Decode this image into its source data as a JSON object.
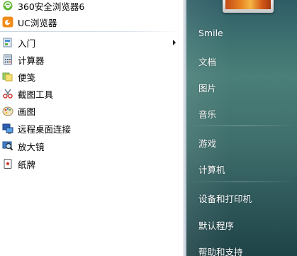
{
  "programs": {
    "pinned": [
      {
        "label": "360安全浏览器6",
        "icon": "360-browser-icon"
      },
      {
        "label": "UC浏览器",
        "icon": "uc-browser-icon"
      }
    ],
    "items": [
      {
        "label": "入门",
        "icon": "getting-started-icon",
        "has_submenu": true
      },
      {
        "label": "计算器",
        "icon": "calculator-icon"
      },
      {
        "label": "便笺",
        "icon": "sticky-notes-icon"
      },
      {
        "label": "截图工具",
        "icon": "snipping-tool-icon"
      },
      {
        "label": "画图",
        "icon": "paint-icon"
      },
      {
        "label": "远程桌面连接",
        "icon": "remote-desktop-icon"
      },
      {
        "label": "放大镜",
        "icon": "magnifier-icon"
      },
      {
        "label": "纸牌",
        "icon": "solitaire-icon"
      }
    ]
  },
  "places": [
    {
      "label": "Smile"
    },
    {
      "label": "文档"
    },
    {
      "label": "图片"
    },
    {
      "label": "音乐"
    },
    {
      "label": "游戏"
    },
    {
      "label": "计算机"
    },
    {
      "label": "设备和打印机"
    },
    {
      "label": "默认程序"
    },
    {
      "label": "帮助和支持"
    }
  ],
  "colors": {
    "places_pane": "#3f7472",
    "programs_pane": "#ffffff"
  }
}
